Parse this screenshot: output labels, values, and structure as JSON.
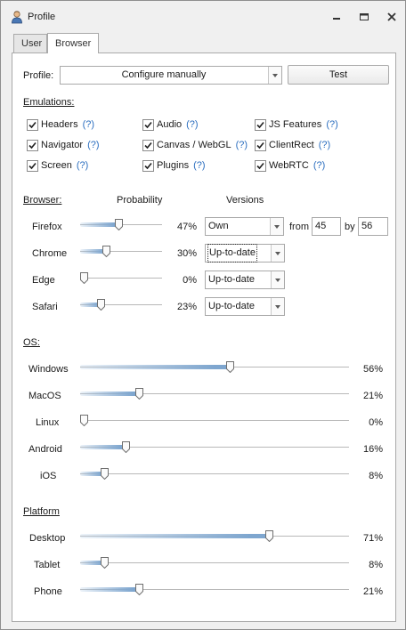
{
  "window": {
    "title": "Profile"
  },
  "tabs": [
    {
      "label": "User"
    },
    {
      "label": "Browser"
    }
  ],
  "profile": {
    "label": "Profile:",
    "value": "Configure manually",
    "test_label": "Test"
  },
  "emulations": {
    "header": "Emulations:",
    "help": "(?)",
    "items": [
      {
        "label": "Headers",
        "checked": true
      },
      {
        "label": "Audio",
        "checked": true
      },
      {
        "label": "JS Features",
        "checked": true
      },
      {
        "label": "Navigator",
        "checked": true
      },
      {
        "label": "Canvas / WebGL",
        "checked": true
      },
      {
        "label": "ClientRect",
        "checked": true
      },
      {
        "label": "Screen",
        "checked": true
      },
      {
        "label": "Plugins",
        "checked": true
      },
      {
        "label": "WebRTC",
        "checked": true
      }
    ]
  },
  "browser": {
    "header": "Browser:",
    "probability_header": "Probability",
    "versions_header": "Versions",
    "rows": [
      {
        "name": "Firefox",
        "value": 47,
        "pct": "47%",
        "version": "Own"
      },
      {
        "name": "Chrome",
        "value": 30,
        "pct": "30%",
        "version": "Up-to-date"
      },
      {
        "name": "Edge",
        "value": 0,
        "pct": "0%",
        "version": "Up-to-date"
      },
      {
        "name": "Safari",
        "value": 23,
        "pct": "23%",
        "version": "Up-to-date"
      }
    ],
    "from_label": "from",
    "from_value": "45",
    "by_label": "by",
    "by_value": "56"
  },
  "os": {
    "header": "OS:",
    "rows": [
      {
        "name": "Windows",
        "value": 56,
        "pct": "56%"
      },
      {
        "name": "MacOS",
        "value": 21,
        "pct": "21%"
      },
      {
        "name": "Linux",
        "value": 0,
        "pct": "0%"
      },
      {
        "name": "Android",
        "value": 16,
        "pct": "16%"
      },
      {
        "name": "iOS",
        "value": 8,
        "pct": "8%"
      }
    ]
  },
  "platform": {
    "header": "Platform",
    "rows": [
      {
        "name": "Desktop",
        "value": 71,
        "pct": "71%"
      },
      {
        "name": "Tablet",
        "value": 8,
        "pct": "8%"
      },
      {
        "name": "Phone",
        "value": 21,
        "pct": "21%"
      }
    ]
  },
  "colors": {
    "accent": "#7ea6cf",
    "help": "#2c6fc0",
    "border": "#a9a9a9"
  }
}
